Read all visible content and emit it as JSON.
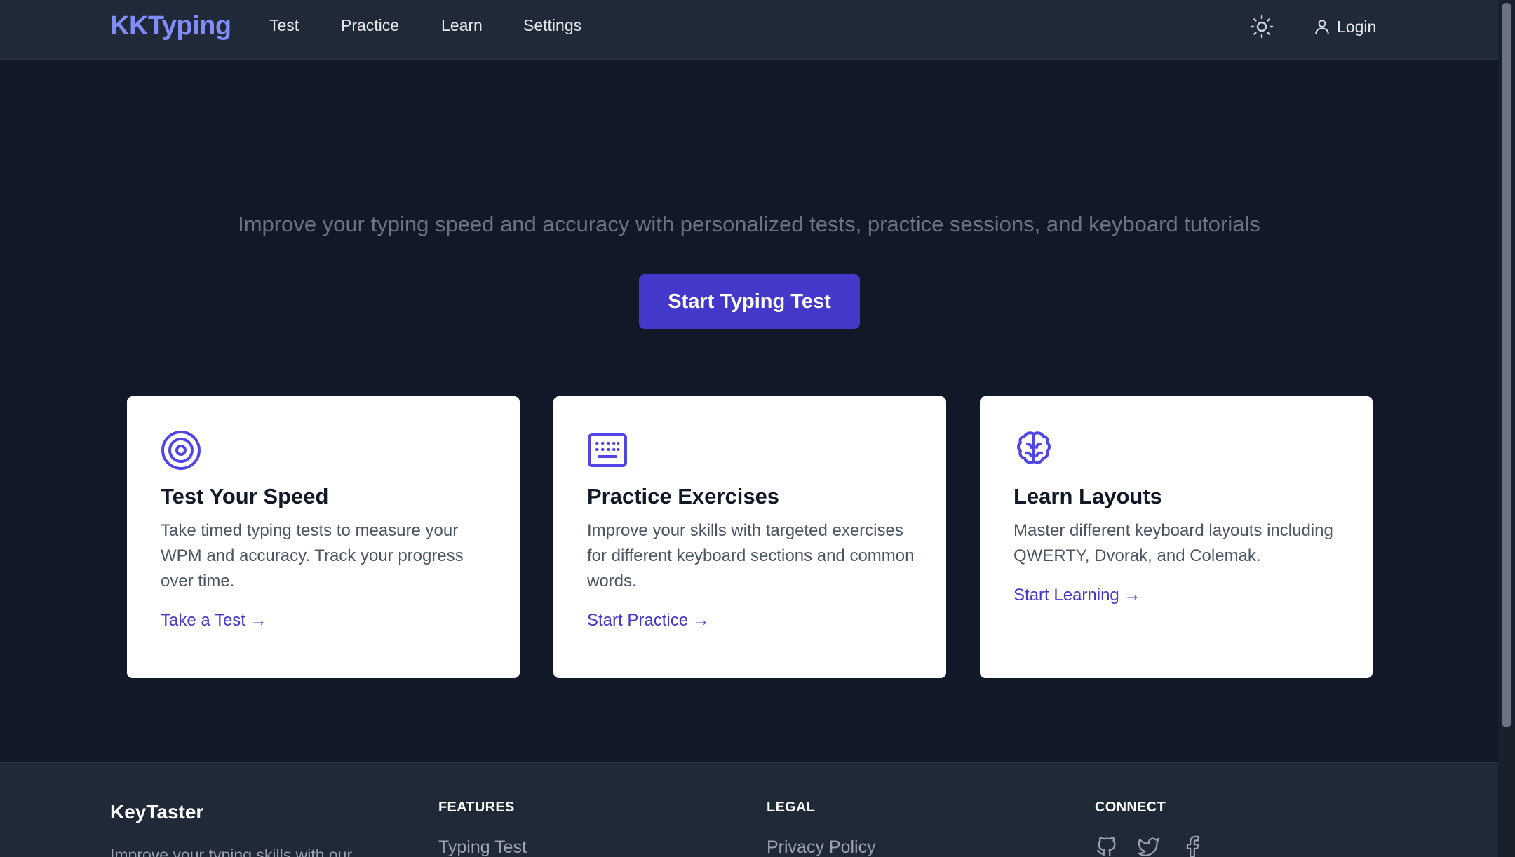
{
  "nav": {
    "brand": "KKTyping",
    "links": [
      "Test",
      "Practice",
      "Learn",
      "Settings"
    ],
    "theme_icon": "sun-icon",
    "login_icon": "user-icon",
    "login_label": "Login"
  },
  "hero": {
    "subtitle": "Improve your typing speed and accuracy with personalized tests, practice sessions, and keyboard tutorials",
    "cta_label": "Start Typing Test"
  },
  "cards": [
    {
      "icon": "target-icon",
      "title": "Test Your Speed",
      "description": "Take timed typing tests to measure your WPM and accuracy. Track your progress over time.",
      "link": "Take a Test →"
    },
    {
      "icon": "keyboard-icon",
      "title": "Practice Exercises",
      "description": "Improve your skills with targeted exercises for different keyboard sections and common words.",
      "link": "Start Practice →"
    },
    {
      "icon": "brain-icon",
      "title": "Learn Layouts",
      "description": "Master different keyboard layouts including QWERTY, Dvorak, and Colemak.",
      "link": "Start Learning →"
    }
  ],
  "footer": {
    "brand": "KeyTaster",
    "tagline": "Improve your typing skills with our",
    "features_heading": "FEATURES",
    "features_first": "Typing Test",
    "legal_heading": "LEGAL",
    "legal_first": "Privacy Policy",
    "connect_heading": "CONNECT",
    "social_icons": [
      "github-icon",
      "twitter-icon",
      "facebook-icon"
    ]
  },
  "colors": {
    "page_bg": "#111827",
    "nav_bg": "#1f2937",
    "brand_accent": "#818cf8",
    "primary": "#4338ca",
    "card_bg": "#ffffff"
  }
}
